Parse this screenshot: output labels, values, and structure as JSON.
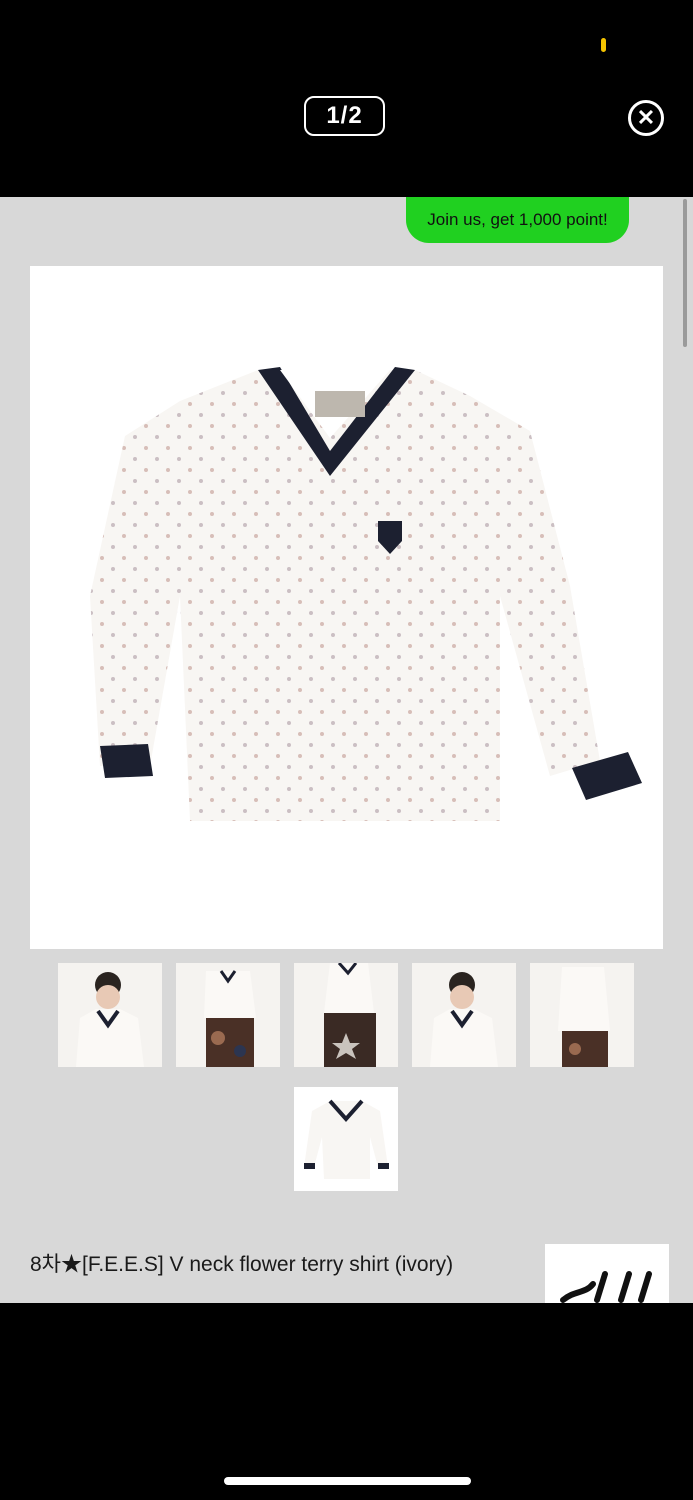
{
  "viewer": {
    "counter": "1/2",
    "close_icon": "close-circle-icon"
  },
  "promo": {
    "label": "Join us, get 1,000 point!"
  },
  "product": {
    "title": "8차★[F.E.E.S] V neck flower terry shirt (ivory)",
    "main_image": "product-main-image",
    "thumbnails": [
      "thumbnail-model-front",
      "thumbnail-model-full",
      "thumbnail-model-star-pants",
      "thumbnail-model-front-2",
      "thumbnail-model-back",
      "thumbnail-flat-shirt"
    ]
  },
  "colors": {
    "accent_green": "#20d020",
    "status_yellow": "#f5c400",
    "shirt_trim": "#1c2030"
  }
}
